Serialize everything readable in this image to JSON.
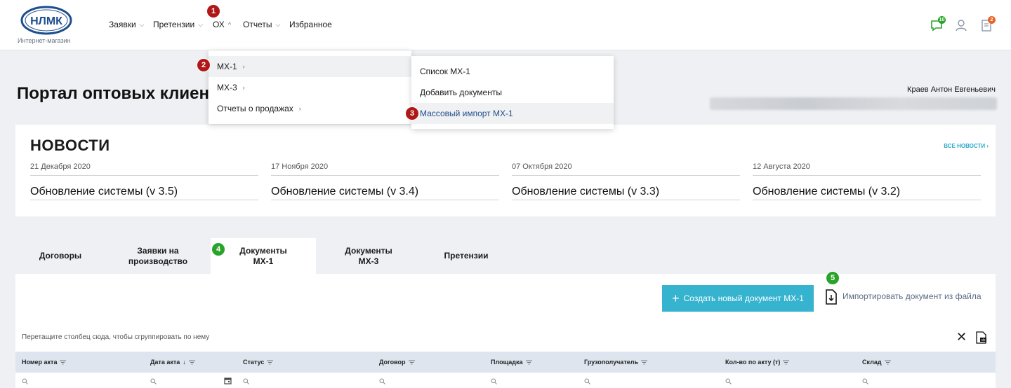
{
  "header": {
    "logo_text": "НЛМК",
    "logo_subtitle": "Интернет-магазин",
    "nav": [
      {
        "label": "Заявки"
      },
      {
        "label": "Претензии"
      },
      {
        "label": "ОХ"
      },
      {
        "label": "Отчеты"
      },
      {
        "label": "Избранное"
      }
    ],
    "notifications_count": "10",
    "cart_count": "2"
  },
  "page": {
    "title": "Портал оптовых клиен",
    "user_name": "Краев Антон Евгеньевич"
  },
  "news": {
    "title": "НОВОСТИ",
    "all_link": "ВСЕ НОВОСТИ",
    "items": [
      {
        "date": "21 Декабря 2020",
        "headline": "Обновление системы (v 3.5)"
      },
      {
        "date": "17 Ноября 2020",
        "headline": "Обновление системы (v 3.4)"
      },
      {
        "date": "07 Октября 2020",
        "headline": "Обновление системы (v 3.3)"
      },
      {
        "date": "12 Августа 2020",
        "headline": "Обновление системы (v 3.2)"
      }
    ]
  },
  "tabs": [
    {
      "label": "Договоры"
    },
    {
      "label": "Заявки на производство"
    },
    {
      "label": "Документы МХ-1"
    },
    {
      "label": "Документы МХ-3"
    },
    {
      "label": "Претензии"
    }
  ],
  "panel": {
    "create_button": "Создать новый документ МХ-1",
    "import_link": "Импортировать документ из файла",
    "group_hint": "Перетащите столбец сюда, чтобы сгруппировать по нему",
    "columns": [
      {
        "label": "Номер акта"
      },
      {
        "label": "Дата акта"
      },
      {
        "label": "Статус"
      },
      {
        "label": "Договор"
      },
      {
        "label": "Площадка"
      },
      {
        "label": "Грузополучатель"
      },
      {
        "label": "Кол-во по акту (т)"
      },
      {
        "label": "Склад"
      }
    ],
    "sort_indicator": "↓"
  },
  "menu_level1": [
    {
      "label": "МХ-1"
    },
    {
      "label": "МХ-3"
    },
    {
      "label": "Отчеты о продажах"
    }
  ],
  "menu_level2": [
    {
      "label": "Список МХ-1"
    },
    {
      "label": "Добавить документы"
    },
    {
      "label": "Массовый импорт МХ-1"
    }
  ],
  "steps": [
    "1",
    "2",
    "3",
    "4",
    "5"
  ],
  "colors": {
    "brand_blue": "#1f4e8c",
    "accent_cyan": "#36b3cf",
    "step_red": "#b01717",
    "step_green": "#29a329"
  }
}
